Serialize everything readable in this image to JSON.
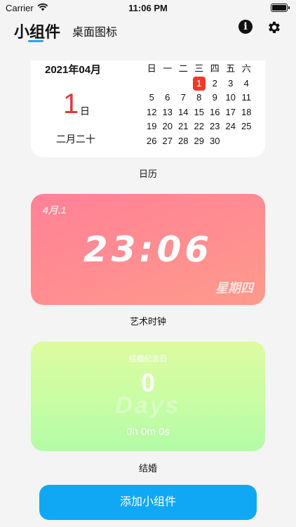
{
  "status_bar": {
    "carrier": "Carrier",
    "time": "11:06 PM"
  },
  "nav": {
    "tabs": [
      {
        "label": "小组件",
        "active": true
      },
      {
        "label": "桌面图标",
        "active": false
      }
    ],
    "info_icon": "info-icon",
    "settings_icon": "gear-icon",
    "info_glyph": "i"
  },
  "calendar_widget": {
    "month_header": "2021年04月",
    "day": "1",
    "day_suffix": "日",
    "lunar_date": "二月二十",
    "weekdays": [
      "日",
      "一",
      "二",
      "三",
      "四",
      "五",
      "六"
    ],
    "weeks": [
      [
        "",
        "",
        "",
        "1",
        "2",
        "3",
        "4"
      ],
      [
        "5",
        "6",
        "7",
        "8",
        "9",
        "10",
        "11"
      ],
      [
        "12",
        "13",
        "14",
        "15",
        "16",
        "17",
        "18"
      ],
      [
        "19",
        "20",
        "21",
        "22",
        "23",
        "24",
        "25"
      ],
      [
        "26",
        "27",
        "28",
        "29",
        "30",
        "",
        ""
      ]
    ],
    "today": "1",
    "today_color": "#f0392b",
    "caption": "日历"
  },
  "clock_widget": {
    "date": "4月.1",
    "time": "23:06",
    "weekday": "星期四",
    "caption": "艺术时钟"
  },
  "anniversary_widget": {
    "title": "结婚纪念日",
    "count": "0",
    "unit_watermark": "Days",
    "elapsed": "0h 0m 0s",
    "caption": "结婚"
  },
  "add_button": {
    "label": "添加小组件",
    "color": "#10a8f4"
  }
}
